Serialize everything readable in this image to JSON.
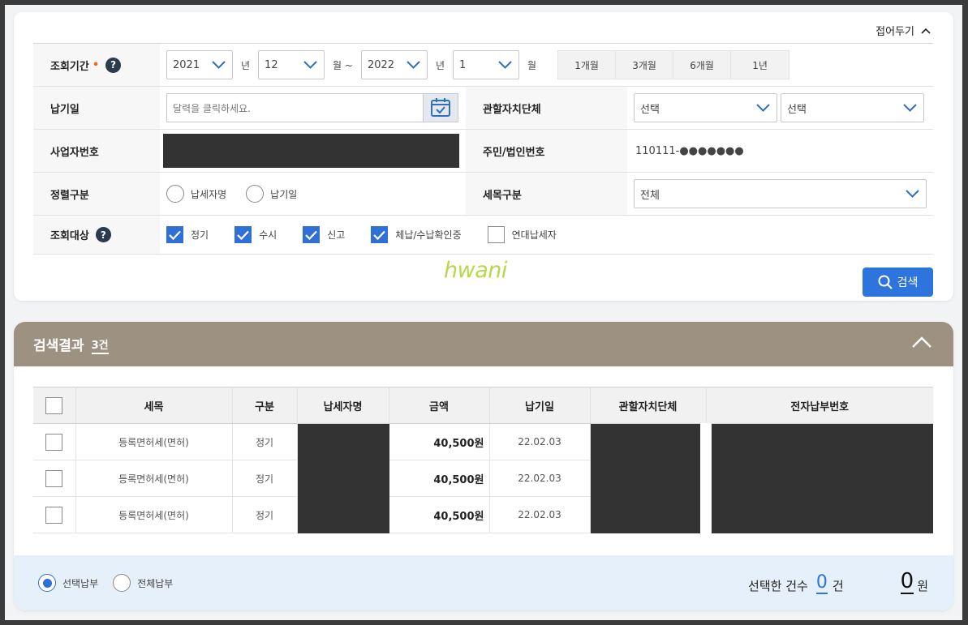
{
  "search": {
    "fold_label": "접어두기",
    "labels": {
      "period": "조회기간",
      "pay_date": "납기일",
      "local_gov": "관할자치단체",
      "biz_no": "사업자번호",
      "resident_no": "주민/법인번호",
      "sort": "정렬구분",
      "tax_item": "세목구분",
      "target": "조회대상"
    },
    "required_mark": "•",
    "help_mark": "?",
    "period": {
      "from_year": "2021",
      "from_month": "12",
      "to_year": "2022",
      "to_month": "1",
      "unit_year": "년",
      "unit_month_sep": "월 ~",
      "unit_month": "월",
      "quick": [
        "1개월",
        "3개월",
        "6개월",
        "1년"
      ]
    },
    "pay_date_placeholder": "달력을 클릭하세요.",
    "local_gov_select": [
      "선택",
      "선택"
    ],
    "resident_no_value": "110111-●●●●●●●",
    "sort_options": [
      {
        "label": "납세자명",
        "selected": false
      },
      {
        "label": "납기일",
        "selected": false
      }
    ],
    "tax_item_value": "전체",
    "targets": [
      {
        "label": "정기",
        "checked": true
      },
      {
        "label": "수시",
        "checked": true
      },
      {
        "label": "신고",
        "checked": true
      },
      {
        "label": "체납/수납확인중",
        "checked": true
      },
      {
        "label": "연대납세자",
        "checked": false
      }
    ],
    "watermark": "hwani",
    "search_button": "검색"
  },
  "results": {
    "title": "검색결과",
    "count": "3건",
    "columns": [
      "세목",
      "구분",
      "납세자명",
      "금액",
      "납기일",
      "관할자치단체",
      "전자납부번호"
    ],
    "rows": [
      {
        "tax": "등록면허세(면허)",
        "type": "정기",
        "amount": "40,500원",
        "date": "22.02.03"
      },
      {
        "tax": "등록면허세(면허)",
        "type": "정기",
        "amount": "40,500원",
        "date": "22.02.03"
      },
      {
        "tax": "등록면허세(면허)",
        "type": "정기",
        "amount": "40,500원",
        "date": "22.02.03"
      }
    ],
    "footer": {
      "pay_options": [
        {
          "label": "선택납부",
          "selected": true
        },
        {
          "label": "전체납부",
          "selected": false
        }
      ],
      "selected_count_label": "선택한 건수",
      "selected_count": "0",
      "count_unit": "건",
      "total": "0",
      "total_unit": "원"
    }
  },
  "colors": {
    "accent": "#2d74dc",
    "header_bg": "#9d9181",
    "footer_bg": "#e6f0fa",
    "required": "#f06b1d"
  }
}
